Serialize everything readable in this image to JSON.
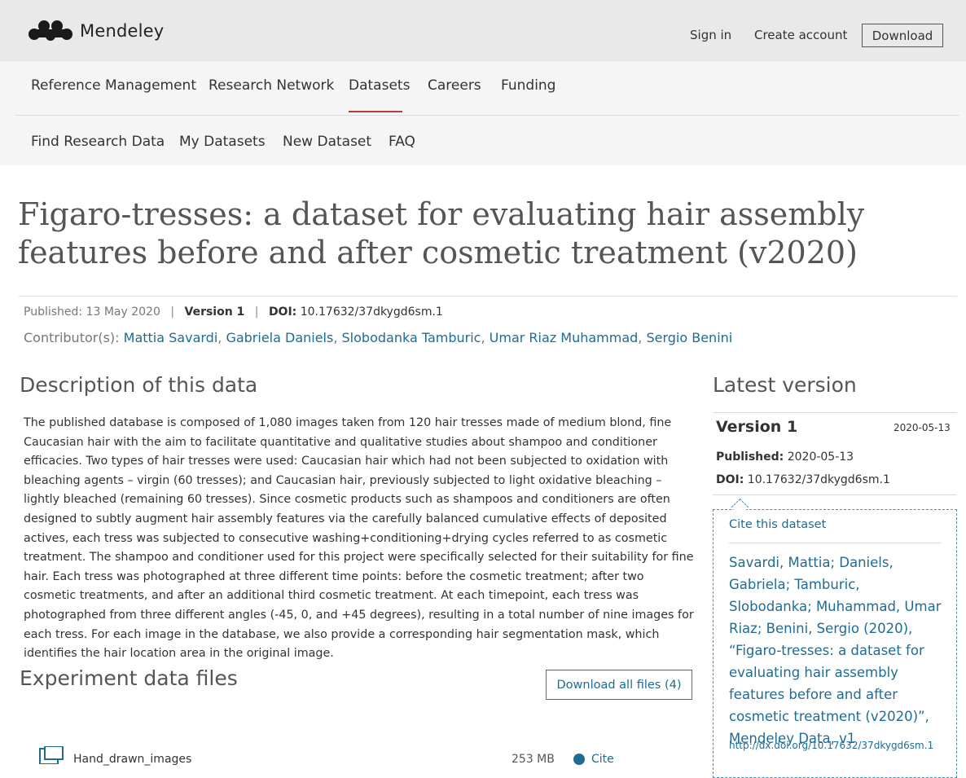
{
  "header": {
    "brand": "Mendeley",
    "sign_in": "Sign in",
    "create_account": "Create account",
    "download": "Download"
  },
  "nav_primary": [
    "Reference Management",
    "Research Network",
    "Datasets",
    "Careers",
    "Funding"
  ],
  "nav_secondary": [
    "Find Research Data",
    "My Datasets",
    "New Dataset",
    "FAQ"
  ],
  "dataset": {
    "title": "Figaro-tresses: a dataset for evaluating hair assembly features before and after cosmetic treatment (v2020)",
    "published_label": "Published:",
    "published_date": "13 May 2020",
    "version": "Version 1",
    "doi_label": "DOI:",
    "doi": "10.17632/37dkygd6sm.1",
    "contributors_label": "Contributor(s):",
    "contributors": [
      "Mattia Savardi",
      "Gabriela Daniels",
      "Slobodanka Tamburic",
      "Umar Riaz Muhammad",
      "Sergio Benini"
    ]
  },
  "description": {
    "heading": "Description of this data",
    "text": "The published database is composed of 1,080 images taken from 120 hair tresses made of medium blond, fine Caucasian hair with the aim to facilitate quantitative and qualitative studies about shampoo and conditioner efficacies. Two types of hair tresses were used: Caucasian hair which had not been subjected to oxidation with bleaching agents – virgin (60 tresses); and Caucasian hair, previously subjected to light oxidative bleaching – lightly bleached (remaining 60 tresses). Since cosmetic products such as shampoos and conditioners are often designed to subtly augment hair assembly features via the carefully balanced cumulative effects of deposited actives, each tress was subjected to consecutive washing+conditioning+drying cycles referred to as cosmetic treatment. The shampoo and conditioner used for this project were specifically selected for their suitability for fine hair. Each tress was photographed at three different time points: before the cosmetic treatment; after two cosmetic treatments, and after an additional third cosmetic treatment. At each timepoint, each tress was photographed from three different angles (-45, 0, and +45 degrees), resulting in a total number of nine images for each tress. For each image in the database, we also provide a corresponding hair segmentation mask, which identifies the hair location area in the original image."
  },
  "files": {
    "heading": "Experiment data files",
    "download_all": "Download all files (4)",
    "first_row": {
      "name": "Hand_drawn_images",
      "size": "253 MB",
      "cite": "Cite"
    }
  },
  "latest_version": {
    "heading": "Latest version",
    "version": "Version 1",
    "date": "2020-05-13",
    "published_label": "Published:",
    "published": "2020-05-13",
    "doi_label": "DOI:",
    "doi": "10.17632/37dkygd6sm.1",
    "cite_heading": "Cite this dataset",
    "citation": "Savardi, Mattia; Daniels, Gabriela; Tamburic, Slobodanka; Muhammad, Umar Riaz; Benini, Sergio (2020), “Figaro-tresses: a dataset for evaluating hair assembly features before and after cosmetic treatment (v2020)”, Mendeley Data, v1",
    "cite_url": "http://dx.doi.org/10.17632/37dkygd6sm.1"
  },
  "colors": {
    "link": "#1f6b93",
    "active_tab_underline": "#b53b34",
    "header_bg": "#e9e9e9",
    "nav_bg": "#f5f5f5"
  }
}
